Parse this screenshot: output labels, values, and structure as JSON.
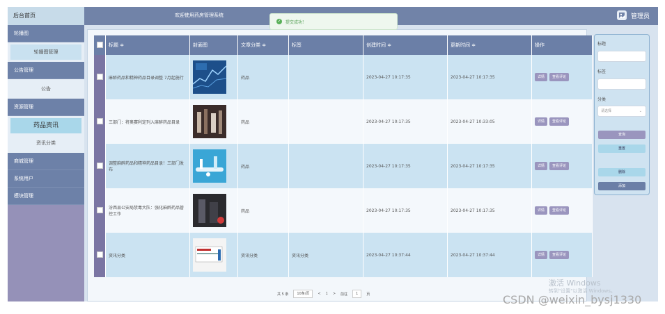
{
  "sidebar": {
    "brand": "后台首页",
    "groups": [
      {
        "label": "轮播图",
        "items": [
          "轮播图管理"
        ]
      },
      {
        "label": "公告管理",
        "items": [
          "公告"
        ]
      },
      {
        "label": "资源管理",
        "items": [
          "药品资讯",
          "资讯分类"
        ]
      },
      {
        "label": "商城管理",
        "items": []
      },
      {
        "label": "系统用户",
        "items": []
      },
      {
        "label": "模块管理",
        "items": []
      }
    ]
  },
  "header": {
    "welcome": "欢迎使用药房管理系统",
    "admin": "管理员"
  },
  "toast": {
    "message": "提交成功!"
  },
  "table": {
    "headers": {
      "title": "标题 ≑",
      "cover": "封面图",
      "category": "文章分类 ≑",
      "tag": "标签",
      "created": "创建时间 ≑",
      "updated": "更新时间 ≑",
      "ops": "操作"
    },
    "rows": [
      {
        "title": "麻醉药品和精神药品目录调整 7月起施行",
        "category": "药品",
        "tag": "",
        "created": "2023-04-27 10:17:35",
        "updated": "2023-04-27 10:17:35"
      },
      {
        "title": "三部门：将奥赛利定列入麻醉药品目录",
        "category": "药品",
        "tag": "",
        "created": "2023-04-27 10:17:35",
        "updated": "2023-04-27 10:33:05"
      },
      {
        "title": "调整麻醉药品和精神药品目录！三部门发布",
        "category": "药品",
        "tag": "",
        "created": "2023-04-27 10:17:35",
        "updated": "2023-04-27 10:17:35"
      },
      {
        "title": "汾西县公安局禁毒大队：强化麻醉药品管控工作",
        "category": "药品",
        "tag": "",
        "created": "2023-04-27 10:17:35",
        "updated": "2023-04-27 10:17:35"
      },
      {
        "title": "资讯分类",
        "category": "资讯分类",
        "tag": "资讯分类",
        "created": "2023-04-27 10:37:44",
        "updated": "2023-04-27 10:37:44"
      }
    ],
    "btn_detail": "详情",
    "btn_comment": "查看评论"
  },
  "pager": {
    "total": "共 5 条",
    "page_size": "10条/页",
    "prev": "<",
    "current": "1",
    "next": ">",
    "goto": "前往",
    "goto_page": "1",
    "page_suffix": "页"
  },
  "filter": {
    "title_label": "标题",
    "tag_label": "标签",
    "category_label": "分类",
    "category_placeholder": "请选择",
    "search": "查询",
    "reset": "重置",
    "delete": "删除",
    "add": "添加"
  },
  "watermark": {
    "line1": "激活 Windows",
    "line2": "转到\"设置\"以激活 Windows。"
  },
  "csdn": "CSDN @weixin_bysj1330"
}
